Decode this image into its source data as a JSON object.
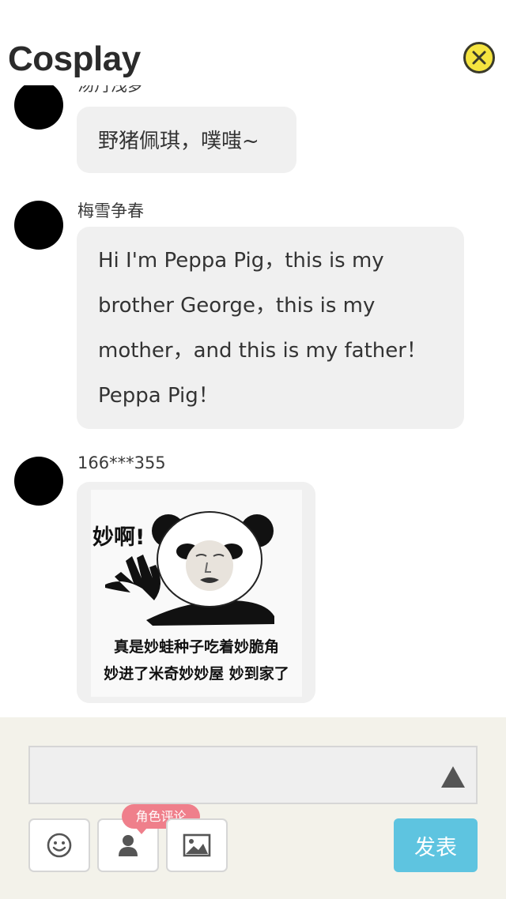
{
  "header": {
    "title": "Cosplay",
    "close_icon": "close-icon",
    "accent_color": "#f5e43f"
  },
  "messages": [
    {
      "username": "汤丹浅梦",
      "lines": [
        "野猪佩琪，噗嗤~"
      ]
    },
    {
      "username": "梅雪争春",
      "lines": [
        "Hi I'm Peppa Pig，this is my",
        "brother George，this is my",
        "mother，and this is my father！",
        "Peppa Pig！"
      ]
    },
    {
      "username": "166***355",
      "image": {
        "exclaim": "妙啊!",
        "caption_lines": [
          "真是妙蛙种子吃着妙脆角",
          "妙进了米奇妙妙屋 妙到家了"
        ]
      }
    }
  ],
  "composer": {
    "input_value": "",
    "input_placeholder": "",
    "emoji_icon": "smiley-icon",
    "role_icon": "person-icon",
    "image_icon": "image-icon",
    "send_icon": "triangle-up-icon",
    "role_tag": "角色评论",
    "publish_label": "发表",
    "publish_color": "#5ec4e0",
    "tag_color": "#ef7f8b"
  }
}
